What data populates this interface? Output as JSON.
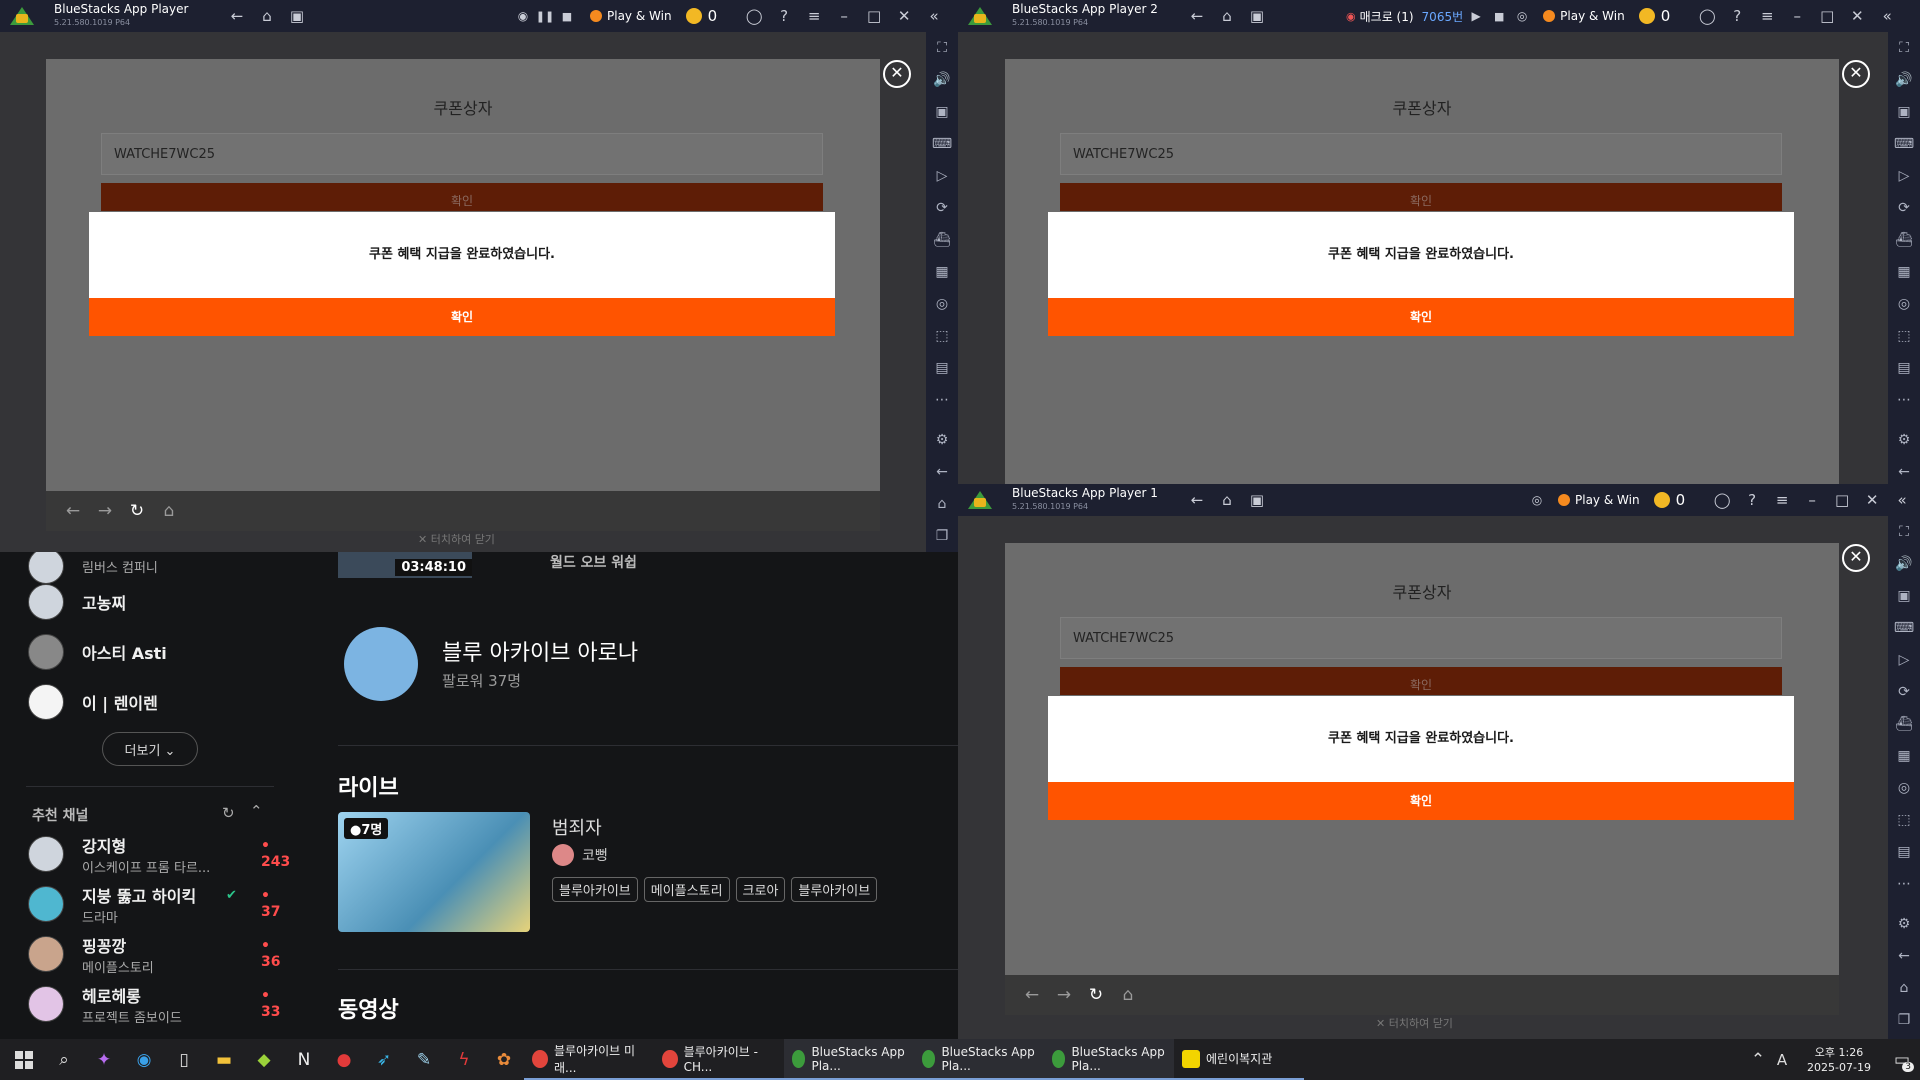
{
  "window_main": {
    "title": "BlueStacks App Player",
    "version": "5.21.580.1019 P64",
    "play_win_label": "Play & Win",
    "coins": "0"
  },
  "window_2": {
    "title": "BlueStacks App Player 2",
    "version": "5.21.580.1019 P64",
    "macro_label": "매크로 (1)",
    "macro_count": "7065번",
    "play_win_label": "Play & Win",
    "coins": "0"
  },
  "window_1": {
    "title": "BlueStacks App Player 1",
    "version": "5.21.580.1019 P64",
    "play_win_label": "Play & Win",
    "coins": "0"
  },
  "coupon_dialog": {
    "title": "쿠폰상자",
    "code_value": "WATCHE7WC25",
    "confirm_label": "확인",
    "message": "쿠폰 혜택 지급을 완료하였습니다.",
    "ok_label": "확인",
    "touch_close": "✕ 터치하여 닫기"
  },
  "icons": {
    "back": "←",
    "home": "⌂",
    "multi": "▣",
    "profile": "◯",
    "help": "?",
    "menu": "≡",
    "minimize": "–",
    "maximize": "□",
    "close": "✕",
    "collapse": "«",
    "pause": "❚❚",
    "stop": "■",
    "play": "▶",
    "reload": "↻",
    "forward": "→"
  },
  "sidebar_icons": [
    "⛶",
    "🔊",
    "▣",
    "⌨",
    "▷",
    "⟳",
    "⛴",
    "▦",
    "◎",
    "⬚",
    "▤",
    "⋯",
    "⚙",
    "←",
    "⌂",
    "❐"
  ],
  "web": {
    "followed": [
      {
        "name": "림버스 컴퍼니",
        "sub": ""
      },
      {
        "name": "고농찌",
        "sub": ""
      },
      {
        "name": "아스티 Asti",
        "sub": ""
      },
      {
        "name": "이 | 렌이렌",
        "sub": ""
      }
    ],
    "more_label": "더보기 ⌄",
    "recommended_title": "추천 채널",
    "recommended": [
      {
        "name": "강지형",
        "sub": "이스케이프 프롬 타르...",
        "count": "• 243"
      },
      {
        "name": "지붕 뚫고 하이킥",
        "sub": "드라마",
        "count": "• 37"
      },
      {
        "name": "핑꽁깡",
        "sub": "메이플스토리",
        "count": "• 36"
      },
      {
        "name": "헤로헤롱",
        "sub": "프로젝트 좀보이드",
        "count": "• 33"
      }
    ],
    "video_time": "03:48:10",
    "video_caption": "월드 오브 워쉽",
    "channel_name": "블루 아카이브 아로나",
    "channel_followers": "팔로워 37명",
    "live_heading": "라이브",
    "live_viewers": "●7명",
    "live_title": "범죄자",
    "live_streamer": "코뻥",
    "live_tags": [
      "블루아카이브",
      "메이플스토리",
      "크로아",
      "블루아카이브"
    ],
    "video_heading": "동영상"
  },
  "taskbar": {
    "apps": [
      {
        "label": "블루아카이브 미래...",
        "color": "#e2453c"
      },
      {
        "label": "블루아카이브 - CH...",
        "color": "#e2453c"
      },
      {
        "label": "BlueStacks App Pla...",
        "color": "#3c9b3c"
      },
      {
        "label": "BlueStacks App Pla...",
        "color": "#3c9b3c"
      },
      {
        "label": "BlueStacks App Pla...",
        "color": "#3c9b3c"
      },
      {
        "label": "에린이복지관",
        "color": "#f2d400"
      }
    ],
    "ime": "A",
    "time": "오후 1:26",
    "date": "2025-07-19",
    "notifications": "3"
  },
  "colors": {
    "accent_orange": "#ff5400",
    "dark_confirm": "#5e1d06",
    "titlebar": "#1d2030"
  }
}
